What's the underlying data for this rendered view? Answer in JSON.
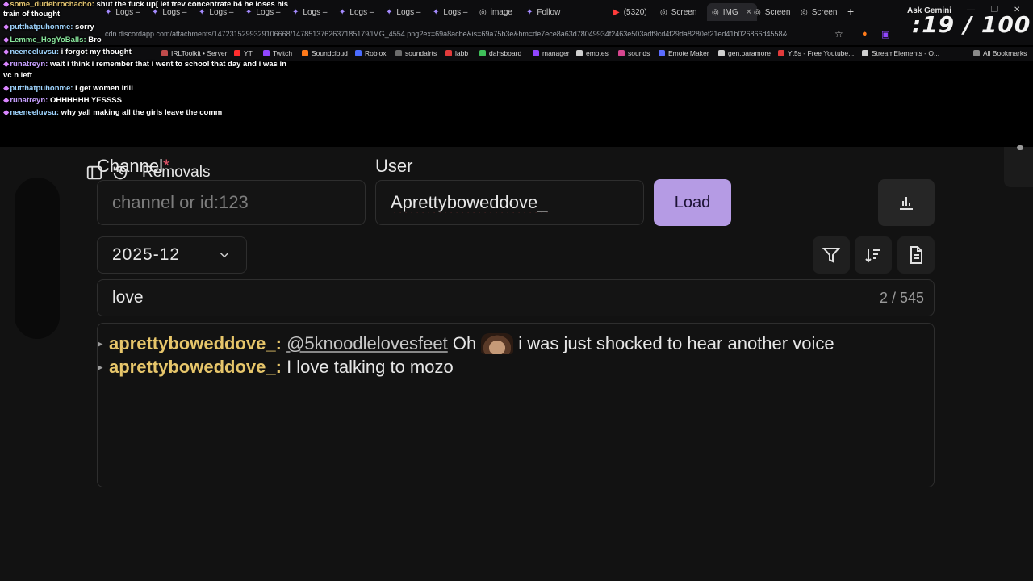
{
  "browser": {
    "tabs": [
      {
        "label": "Logs –",
        "icon": "twitch-icon"
      },
      {
        "label": "Logs –",
        "icon": "twitch-icon"
      },
      {
        "label": "Logs –",
        "icon": "twitch-icon"
      },
      {
        "label": "Logs –",
        "icon": "twitch-icon"
      },
      {
        "label": "Logs –",
        "icon": "twitch-icon"
      },
      {
        "label": "Logs –",
        "icon": "twitch-icon"
      },
      {
        "label": "Logs –",
        "icon": "twitch-icon"
      },
      {
        "label": "Logs –",
        "icon": "twitch-icon"
      },
      {
        "label": "image",
        "icon": "globe-icon"
      },
      {
        "label": "Follow",
        "icon": "twitch-icon"
      },
      {
        "label": "(5320)",
        "icon": "youtube-icon"
      },
      {
        "label": "Screen",
        "icon": "globe-icon"
      },
      {
        "label": "IMG",
        "icon": "globe-icon",
        "active": true
      },
      {
        "label": "Screen",
        "icon": "globe-icon"
      },
      {
        "label": "Screen",
        "icon": "globe-icon"
      }
    ],
    "ask_gemini": "Ask Gemini",
    "url": "cdn.discordapp.com/attachments/1472315299329106668/1478513762637185179/IMG_4554.png?ex=69a8acbe&is=69a75b3e&hm=de7ece8a63d78049934f2463e503adf9cd4f29da8280ef21ed41b026866d4558&",
    "bookmarks": [
      {
        "label": "IRLToolkit • Server",
        "color": "#c04b4b"
      },
      {
        "label": "YT",
        "color": "#ff2d2d"
      },
      {
        "label": "Twitch",
        "color": "#9146ff"
      },
      {
        "label": "Soundcloud",
        "color": "#ff7a1a"
      },
      {
        "label": "Roblox",
        "color": "#4b6cff"
      },
      {
        "label": "soundalrts",
        "color": "#6c6c6c"
      },
      {
        "label": "labb",
        "color": "#e33b3b"
      },
      {
        "label": "dahsboard",
        "color": "#3fbf5a"
      },
      {
        "label": "manager",
        "color": "#9146ff"
      },
      {
        "label": "emotes",
        "color": "#cfcfcf"
      },
      {
        "label": "sounds",
        "color": "#d7468f"
      },
      {
        "label": "Emote Maker",
        "color": "#5b6cff"
      },
      {
        "label": "gen.paramore",
        "color": "#cfcfcf"
      },
      {
        "label": "Yt5s - Free Youtube...",
        "color": "#e23b3b"
      },
      {
        "label": "StreamElements - O...",
        "color": "#cfcfcf"
      },
      {
        "label": "All Bookmarks",
        "color": "#8a8a8a"
      }
    ]
  },
  "overlay": {
    "counter": ":19 / 100",
    "chat": [
      {
        "user": "some_dudebrochacho",
        "text": "shut the fuck up[ let trev concentrate b4 he loses his",
        "tone": "y"
      },
      {
        "user": "",
        "text": "train of thought",
        "tone": ""
      },
      {
        "user": "putthatpuhonme",
        "text": "sorry",
        "tone": "c"
      },
      {
        "user": "Lemme_HogYoBalls",
        "text": "Bro",
        "tone": "g"
      },
      {
        "user": "neeneeluvsu",
        "text": "i forgot my thought",
        "tone": "c"
      },
      {
        "user": "runatreyn",
        "text": "wait i think i remember that i went to school that day and i was in",
        "tone": ""
      },
      {
        "user": "",
        "text": "vc n left",
        "tone": ""
      },
      {
        "user": "putthatpuhonme",
        "text": "i get women irlll",
        "tone": "c"
      },
      {
        "user": "runatreyn",
        "text": "OHHHHHH YESSSS",
        "tone": ""
      },
      {
        "user": "neeneeluvsu",
        "text": "why yall making all the girls leave the comm",
        "tone": "c"
      }
    ]
  },
  "app": {
    "removals_label": "Removals",
    "channel": {
      "label": "Channel",
      "required": "*",
      "placeholder": "channel or id:123",
      "value": ""
    },
    "user": {
      "label": "User",
      "value": "Aprettybowed​dove_"
    },
    "load_label": "Load",
    "month": "2025-12",
    "search": {
      "value": "love",
      "count": "2 / 545"
    },
    "messages": [
      {
        "author": "aprettyboweddove_:",
        "mention": "@5knoodlelovesfeet",
        "before_emote": "Oh",
        "after_emote": "i was just shocked to hear another voice",
        "has_emote": true
      },
      {
        "author": "aprettyboweddove_:",
        "mention": "",
        "before_emote": "I love talking to mozo",
        "after_emote": "",
        "has_emote": false
      }
    ]
  },
  "colors": {
    "accent": "#b59be4",
    "author": "#e6c56a",
    "required": "#e2546a"
  }
}
